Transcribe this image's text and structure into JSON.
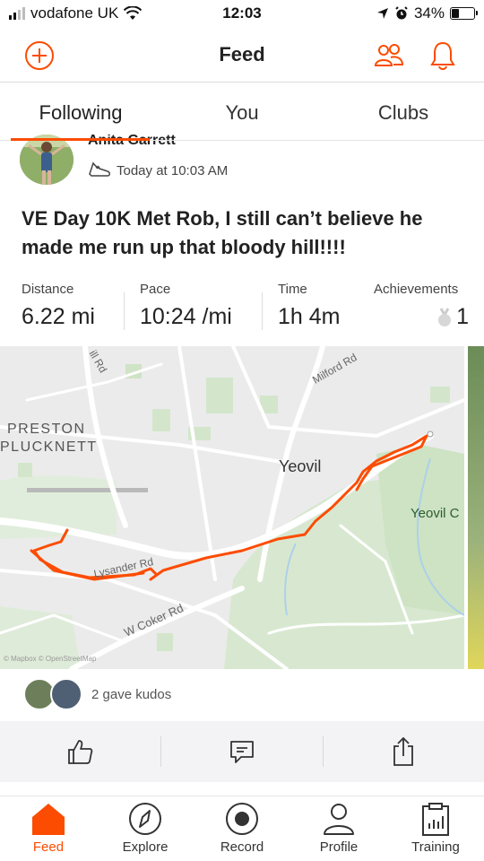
{
  "status_bar": {
    "carrier": "vodafone UK",
    "time": "12:03",
    "battery": "34%",
    "battery_level": 0.34
  },
  "header": {
    "title": "Feed"
  },
  "tabs": [
    {
      "label": "Following",
      "active": true
    },
    {
      "label": "You",
      "active": false
    },
    {
      "label": "Clubs",
      "active": false
    }
  ],
  "post": {
    "athlete_name": "Anita Garrett",
    "timestamp": "Today at 10:03 AM",
    "title": "VE Day 10K Met Rob, I still can’t believe he made me run up that bloody hill!!!!",
    "stats": {
      "distance_label": "Distance",
      "distance_value": "6.22 mi",
      "pace_label": "Pace",
      "pace_value": "10:24 /mi",
      "time_label": "Time",
      "time_value": "1h 4m",
      "achievements_label": "Achievements",
      "achievements_value": "1"
    },
    "map": {
      "labels": {
        "preston": "PRESTON",
        "plucknett": "PLUCKNETT",
        "yeovil": "Yeovil",
        "yeovil_country": "Yeovil C",
        "milford_rd": "Milford Rd",
        "hill_rd": "ill Rd",
        "lysander_rd": "Lysander Rd",
        "w_coker_rd": "W Coker Rd",
        "attribution": "© Mapbox © OpenStreetMap"
      },
      "route_color": "#fc4c02"
    },
    "kudos_text": "2 gave kudos"
  },
  "bottom_nav": [
    {
      "label": "Feed",
      "active": true
    },
    {
      "label": "Explore",
      "active": false
    },
    {
      "label": "Record",
      "active": false
    },
    {
      "label": "Profile",
      "active": false
    },
    {
      "label": "Training",
      "active": false
    }
  ],
  "colors": {
    "accent": "#fc4c02"
  },
  "icons": {
    "header_left": "add-circle-icon",
    "header_right": [
      "people-icon",
      "bell-icon"
    ],
    "post_meta": "shoe-icon",
    "achievement": "medal-icon",
    "actions": [
      "thumbs-up-icon",
      "comment-icon",
      "share-icon"
    ]
  }
}
